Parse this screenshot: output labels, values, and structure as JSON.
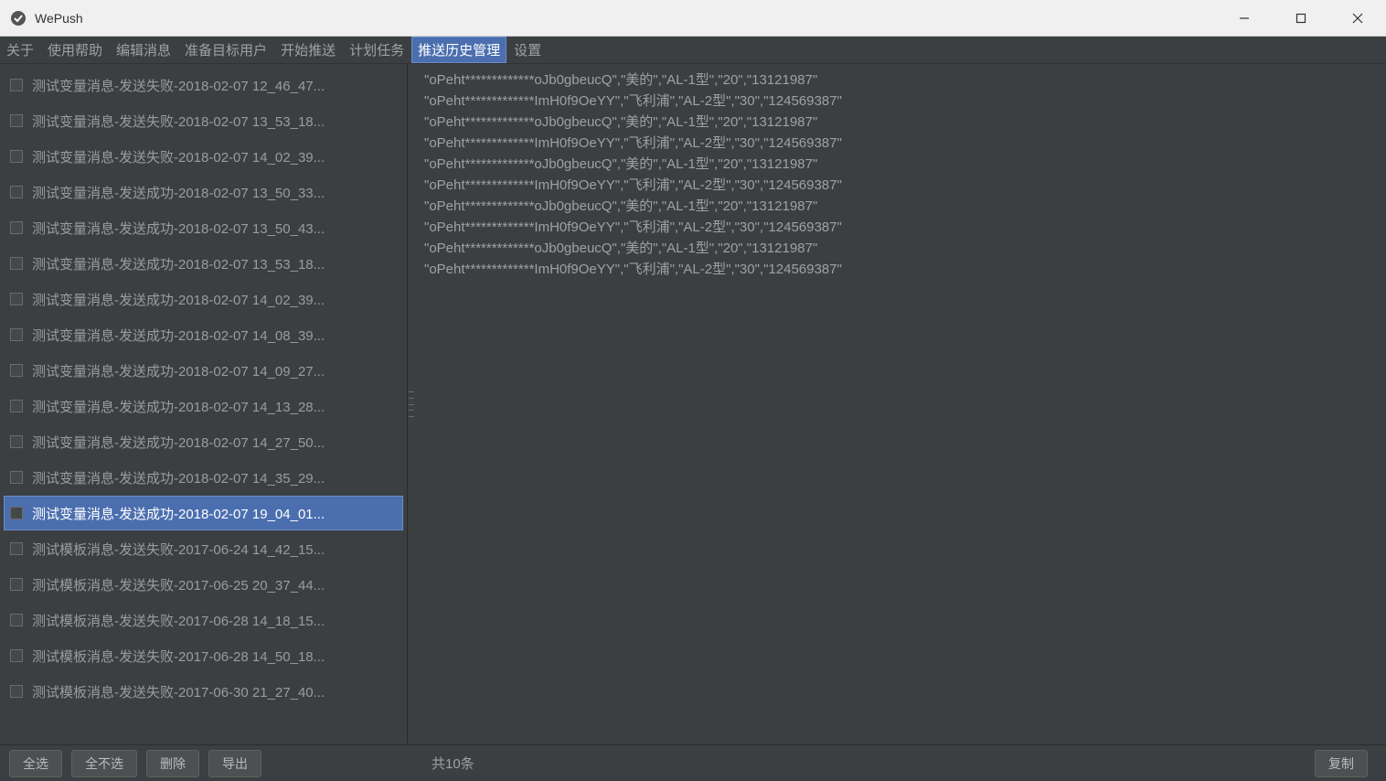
{
  "app": {
    "title": "WePush"
  },
  "menu": {
    "items": [
      "关于",
      "使用帮助",
      "编辑消息",
      "准备目标用户",
      "开始推送",
      "计划任务",
      "推送历史管理",
      "设置"
    ],
    "active_index": 6
  },
  "list": {
    "selected_index": 12,
    "items": [
      "测试变量消息-发送失败-2018-02-07 12_46_47...",
      "测试变量消息-发送失败-2018-02-07 13_53_18...",
      "测试变量消息-发送失败-2018-02-07 14_02_39...",
      "测试变量消息-发送成功-2018-02-07 13_50_33...",
      "测试变量消息-发送成功-2018-02-07 13_50_43...",
      "测试变量消息-发送成功-2018-02-07 13_53_18...",
      "测试变量消息-发送成功-2018-02-07 14_02_39...",
      "测试变量消息-发送成功-2018-02-07 14_08_39...",
      "测试变量消息-发送成功-2018-02-07 14_09_27...",
      "测试变量消息-发送成功-2018-02-07 14_13_28...",
      "测试变量消息-发送成功-2018-02-07 14_27_50...",
      "测试变量消息-发送成功-2018-02-07 14_35_29...",
      "测试变量消息-发送成功-2018-02-07 19_04_01...",
      "测试模板消息-发送失败-2017-06-24 14_42_15...",
      "测试模板消息-发送失败-2017-06-25 20_37_44...",
      "测试模板消息-发送失败-2017-06-28 14_18_15...",
      "测试模板消息-发送失败-2017-06-28 14_50_18...",
      "测试模板消息-发送失败-2017-06-30 21_27_40..."
    ]
  },
  "detail": {
    "lines": [
      "\"oPeht*************oJb0gbeucQ\",\"美的\",\"AL-1型\",\"20\",\"13121987\"",
      "\"oPeht*************ImH0f9OeYY\",\"飞利浦\",\"AL-2型\",\"30\",\"124569387\"",
      "\"oPeht*************oJb0gbeucQ\",\"美的\",\"AL-1型\",\"20\",\"13121987\"",
      "\"oPeht*************ImH0f9OeYY\",\"飞利浦\",\"AL-2型\",\"30\",\"124569387\"",
      "\"oPeht*************oJb0gbeucQ\",\"美的\",\"AL-1型\",\"20\",\"13121987\"",
      "\"oPeht*************ImH0f9OeYY\",\"飞利浦\",\"AL-2型\",\"30\",\"124569387\"",
      "\"oPeht*************oJb0gbeucQ\",\"美的\",\"AL-1型\",\"20\",\"13121987\"",
      "\"oPeht*************ImH0f9OeYY\",\"飞利浦\",\"AL-2型\",\"30\",\"124569387\"",
      "\"oPeht*************oJb0gbeucQ\",\"美的\",\"AL-1型\",\"20\",\"13121987\"",
      "\"oPeht*************ImH0f9OeYY\",\"飞利浦\",\"AL-2型\",\"30\",\"124569387\""
    ]
  },
  "bottom": {
    "select_all": "全选",
    "select_none": "全不选",
    "delete": "删除",
    "export": "导出",
    "count": "共10条",
    "copy": "复制"
  }
}
